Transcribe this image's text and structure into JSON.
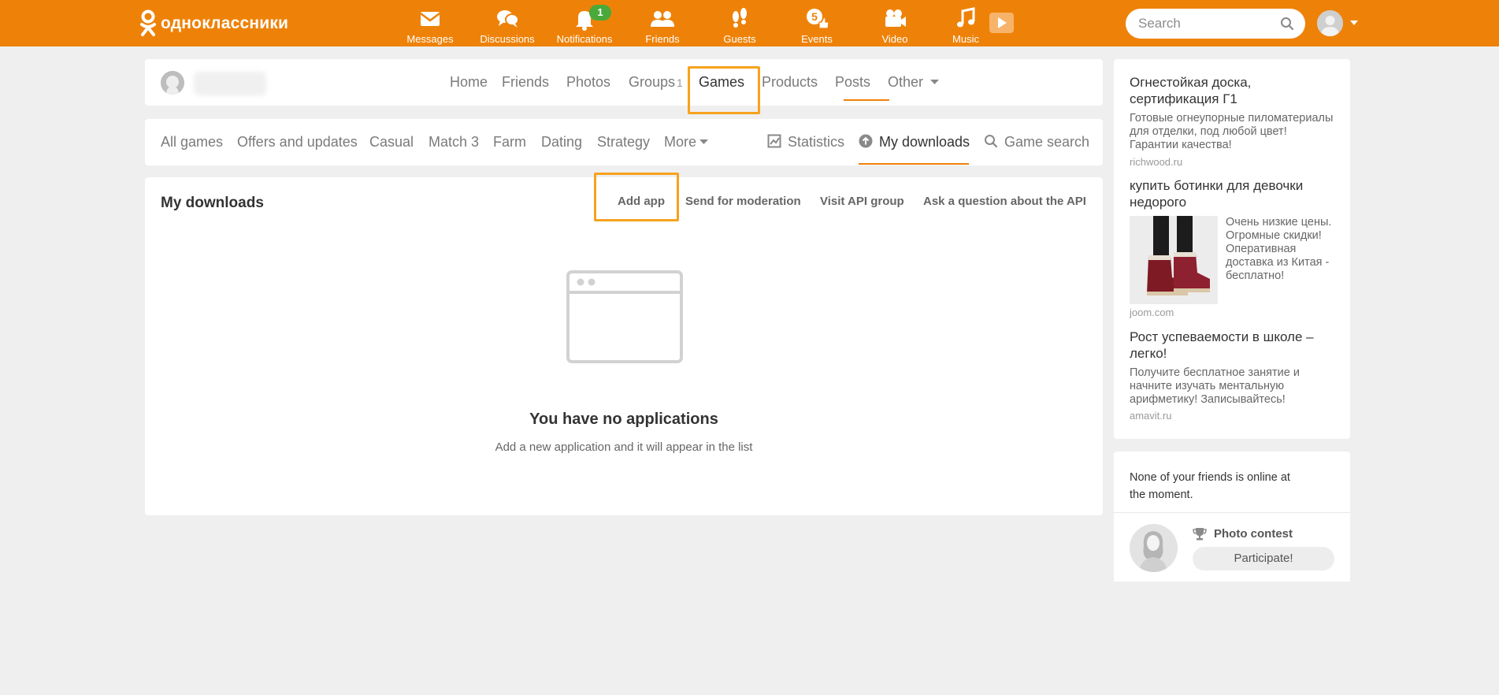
{
  "header": {
    "logo_text": "одноклассники",
    "nav": [
      {
        "id": "messages",
        "label": "Messages"
      },
      {
        "id": "discussions",
        "label": "Discussions"
      },
      {
        "id": "notifications",
        "label": "Notifications",
        "badge": "1"
      },
      {
        "id": "friends",
        "label": "Friends"
      },
      {
        "id": "guests",
        "label": "Guests"
      },
      {
        "id": "events",
        "label": "Events",
        "badge": "5"
      },
      {
        "id": "video",
        "label": "Video"
      },
      {
        "id": "music",
        "label": "Music"
      }
    ],
    "search_placeholder": "Search"
  },
  "profile_nav": {
    "items": [
      {
        "label": "Home"
      },
      {
        "label": "Friends"
      },
      {
        "label": "Photos"
      },
      {
        "label": "Groups",
        "count": "1"
      },
      {
        "label": "Games",
        "active": true
      },
      {
        "label": "Products"
      },
      {
        "label": "Posts"
      },
      {
        "label": "Other"
      }
    ]
  },
  "games_nav": {
    "categories": [
      "All games",
      "Offers and updates",
      "Casual",
      "Match 3",
      "Farm",
      "Dating",
      "Strategy",
      "More"
    ],
    "tools": [
      {
        "label": "Statistics",
        "icon": "chart-icon"
      },
      {
        "label": "My downloads",
        "icon": "upload-icon",
        "active": true
      },
      {
        "label": "Game search",
        "icon": "search-icon"
      }
    ]
  },
  "downloads": {
    "title": "My downloads",
    "actions": [
      "Add app",
      "Send for moderation",
      "Visit API group",
      "Ask a question about the API"
    ],
    "empty_title": "You have no applications",
    "empty_subtitle": "Add a new application and it will appear in the list"
  },
  "ads": [
    {
      "title": "Огнестойкая доска, сертификация Г1",
      "text": "Готовые огнеупорные пиломатериалы для отделки, под любой цвет! Гарантии качества!",
      "domain": "richwood.ru"
    },
    {
      "title": "купить ботинки для девочки недорого",
      "text": "Очень низкие цены. Огромные скидки! Оперативная доставка из Китая - бесплатно!",
      "domain": "joom.com"
    },
    {
      "title": "Рост успеваемости в школе – легко!",
      "text": "Получите бесплатное занятие и начните изучать ментальную арифметику! Записывайтесь!",
      "domain": "amavit.ru"
    }
  ],
  "friends_online": {
    "text": "None of your friends is online at the moment."
  },
  "photo_contest": {
    "title": "Photo contest",
    "button": "Participate!"
  },
  "colors": {
    "brand_orange": "#ee8208",
    "highlight_orange": "#f7a21d",
    "badge_green": "#49a93a",
    "page_bg": "#efefef"
  }
}
